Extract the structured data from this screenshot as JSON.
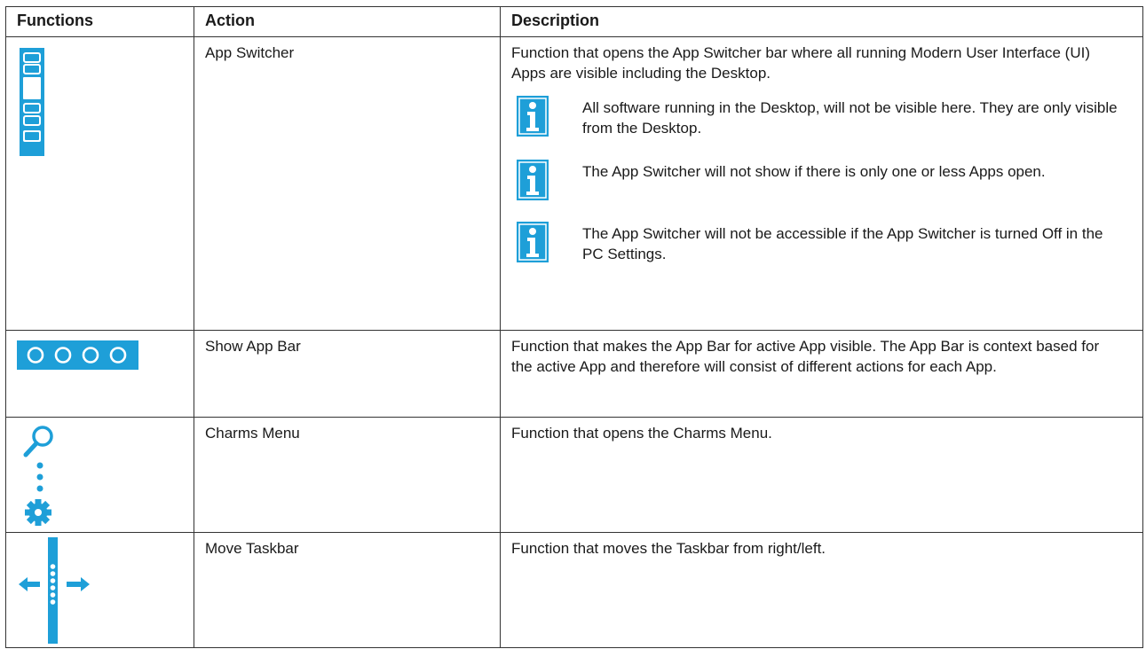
{
  "colors": {
    "accent": "#1e9fd8",
    "border": "#333333",
    "text": "#1a1a1a"
  },
  "header": {
    "functions": "Functions",
    "action": "Action",
    "description": "Description"
  },
  "rows": [
    {
      "icon": "app-switcher-icon",
      "action": "App Switcher",
      "description": "Function that opens the App Switcher bar where all running Modern User Interface (UI) Apps are visible including the Desktop.",
      "notes": [
        {
          "icon": "info-icon",
          "text": "All software running in the Desktop, will not be visible here. They are only visible from the Desktop."
        },
        {
          "icon": "info-icon",
          "text": "The App Switcher will not show if there is only one or less Apps open."
        },
        {
          "icon": "info-icon",
          "text": "The App Switcher will not be accessible if the App Switcher is turned Off in the PC Settings."
        }
      ]
    },
    {
      "icon": "app-bar-icon",
      "action": "Show App Bar",
      "description": "Function that makes the App Bar for active App visible. The App Bar is context based for the active App and therefore will consist of different actions for each App."
    },
    {
      "icon": "charms-icon",
      "action": "Charms Menu",
      "description": "Function that opens the Charms Menu."
    },
    {
      "icon": "move-taskbar-icon",
      "action": "Move Taskbar",
      "description": "Function that moves the Taskbar from right/left."
    }
  ]
}
